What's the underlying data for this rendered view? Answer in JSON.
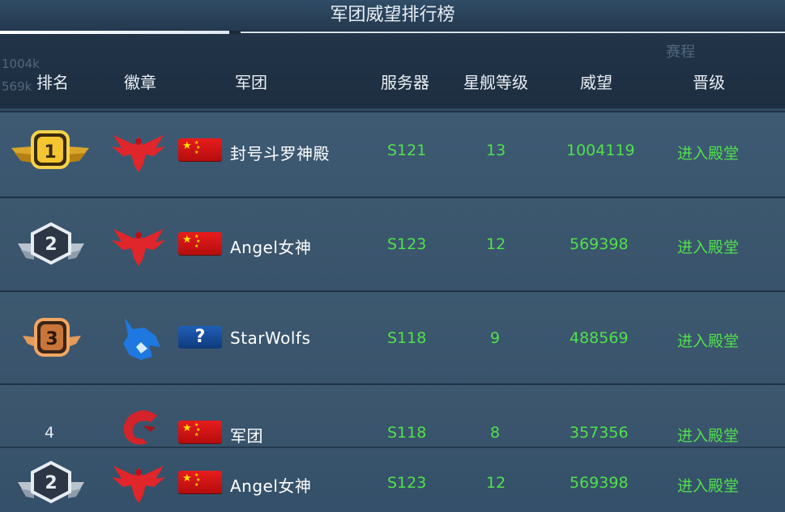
{
  "title": "军团威望排行榜",
  "background_text": {
    "schedule": "赛程",
    "v1": "1004k",
    "v2": "569k"
  },
  "headers": {
    "rank": "排名",
    "badge": "徽章",
    "legion": "军团",
    "server": "服务器",
    "ship_level": "星舰等级",
    "prestige": "威望",
    "promotion": "晋级"
  },
  "rows": [
    {
      "rank": "1",
      "badge": "red-eagle",
      "flag": "china",
      "name": "封号斗罗神殿",
      "server": "S121",
      "level": "13",
      "prestige": "1004119",
      "action": "进入殿堂"
    },
    {
      "rank": "2",
      "badge": "red-eagle",
      "flag": "china",
      "name": "Angel女神",
      "server": "S123",
      "level": "12",
      "prestige": "569398",
      "action": "进入殿堂"
    },
    {
      "rank": "3",
      "badge": "blue-wolf",
      "flag": "unknown",
      "name": "StarWolfs",
      "server": "S118",
      "level": "9",
      "prestige": "488569",
      "action": "进入殿堂"
    },
    {
      "rank": "4",
      "badge": "red-dragon",
      "flag": "china",
      "name": "军团",
      "server": "S118",
      "level": "8",
      "prestige": "357356",
      "action": "进入殿堂"
    }
  ],
  "my_row": {
    "rank": "2",
    "badge": "red-eagle",
    "flag": "china",
    "name": "Angel女神",
    "server": "S123",
    "level": "12",
    "prestige": "569398",
    "action": "进入殿堂"
  },
  "colors": {
    "green": "#51e04c",
    "header_bg": "#213448",
    "row_bg": "#3a566f"
  }
}
